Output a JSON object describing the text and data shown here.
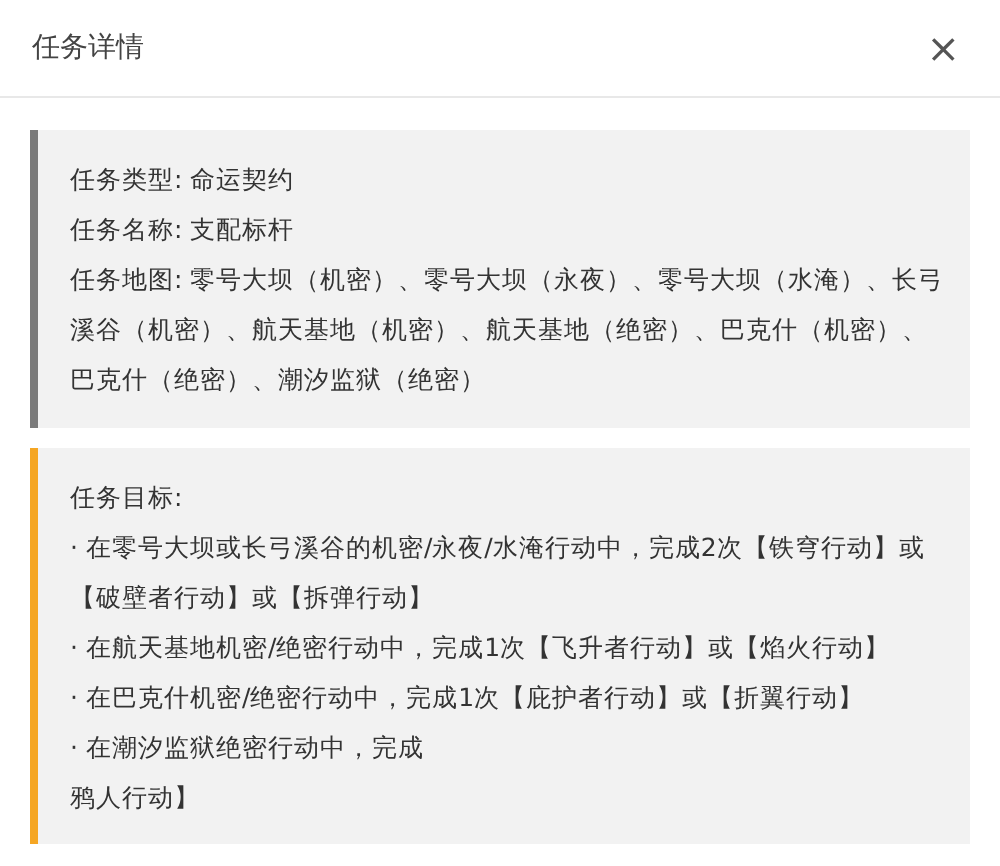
{
  "dialog": {
    "title": "任务详情",
    "close": "×"
  },
  "info": {
    "lines": [
      "任务类型: 命运契约",
      "任务名称: 支配标杆",
      "任务地图: 零号大坝（机密）、零号大坝（永夜）、零号大坝（水淹）、长弓溪谷（机密）、航天基地（机密）、航天基地（绝密）、巴克什（机密）、巴克什（绝密）、潮汐监狱（绝密）"
    ]
  },
  "objectives": {
    "heading": "任务目标:",
    "lines": [
      "· 在零号大坝或长弓溪谷的机密/永夜/水淹行动中，完成2次【铁穹行动】或【破壁者行动】或【拆弹行动】",
      "· 在航天基地机密/绝密行动中，完成1次【飞升者行动】或【焰火行动】",
      "· 在巴克什机密/绝密行动中，完成1次【庇护者行动】或【折翼行动】",
      "· 在潮汐监狱绝密行动中，完成",
      "鸦人行动】"
    ]
  }
}
